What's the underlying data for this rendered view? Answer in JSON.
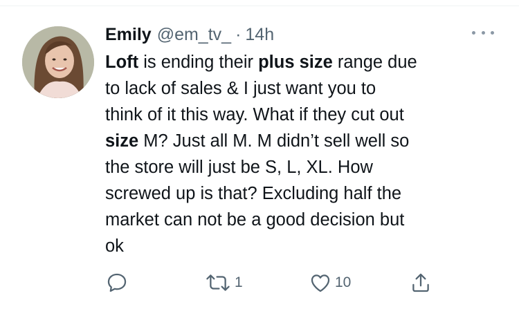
{
  "tweet": {
    "author_name": "Emily",
    "author_handle": "@em_tv_",
    "separator": "·",
    "timestamp": "14h",
    "lines": [
      {
        "segments": [
          {
            "text": "Loft",
            "bold": true
          },
          {
            "text": " is ending their ",
            "bold": false
          },
          {
            "text": "plus size",
            "bold": true
          },
          {
            "text": " range due",
            "bold": false
          }
        ]
      },
      {
        "segments": [
          {
            "text": "to lack of sales & I just want you to",
            "bold": false
          }
        ]
      },
      {
        "segments": [
          {
            "text": "think of it this way. What if they cut out",
            "bold": false
          }
        ]
      },
      {
        "segments": [
          {
            "text": "size",
            "bold": true
          },
          {
            "text": " M? Just all M. M didn’t sell well so",
            "bold": false
          }
        ]
      },
      {
        "segments": [
          {
            "text": "the store will just be S, L, XL. How",
            "bold": false
          }
        ]
      },
      {
        "segments": [
          {
            "text": "screwed up is that? Excluding half the",
            "bold": false
          }
        ]
      },
      {
        "segments": [
          {
            "text": "market can not be a good decision but",
            "bold": false
          }
        ]
      },
      {
        "segments": [
          {
            "text": "ok",
            "bold": false
          }
        ]
      }
    ]
  },
  "actions": {
    "reply_count": "",
    "retweet_count": "1",
    "like_count": "10"
  },
  "icons": {
    "more": "more-horizontal-icon",
    "reply": "reply-icon",
    "retweet": "retweet-icon",
    "like": "heart-icon",
    "share": "share-icon"
  },
  "colors": {
    "text": "#0f1419",
    "secondary": "#536471"
  }
}
